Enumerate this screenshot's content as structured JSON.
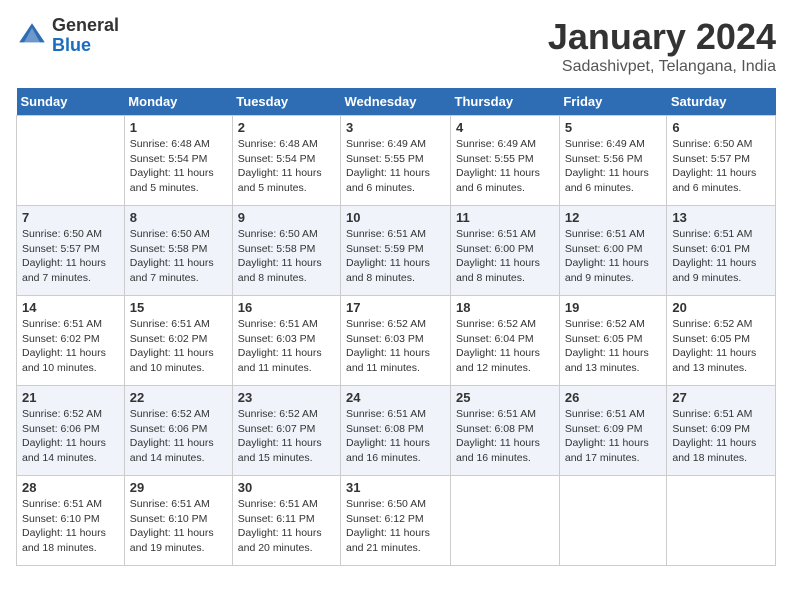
{
  "header": {
    "logo_general": "General",
    "logo_blue": "Blue",
    "month_title": "January 2024",
    "location": "Sadashivpet, Telangana, India"
  },
  "days_of_week": [
    "Sunday",
    "Monday",
    "Tuesday",
    "Wednesday",
    "Thursday",
    "Friday",
    "Saturday"
  ],
  "weeks": [
    [
      {
        "day": "",
        "sunrise": "",
        "sunset": "",
        "daylight": ""
      },
      {
        "day": "1",
        "sunrise": "Sunrise: 6:48 AM",
        "sunset": "Sunset: 5:54 PM",
        "daylight": "Daylight: 11 hours and 5 minutes."
      },
      {
        "day": "2",
        "sunrise": "Sunrise: 6:48 AM",
        "sunset": "Sunset: 5:54 PM",
        "daylight": "Daylight: 11 hours and 5 minutes."
      },
      {
        "day": "3",
        "sunrise": "Sunrise: 6:49 AM",
        "sunset": "Sunset: 5:55 PM",
        "daylight": "Daylight: 11 hours and 6 minutes."
      },
      {
        "day": "4",
        "sunrise": "Sunrise: 6:49 AM",
        "sunset": "Sunset: 5:55 PM",
        "daylight": "Daylight: 11 hours and 6 minutes."
      },
      {
        "day": "5",
        "sunrise": "Sunrise: 6:49 AM",
        "sunset": "Sunset: 5:56 PM",
        "daylight": "Daylight: 11 hours and 6 minutes."
      },
      {
        "day": "6",
        "sunrise": "Sunrise: 6:50 AM",
        "sunset": "Sunset: 5:57 PM",
        "daylight": "Daylight: 11 hours and 6 minutes."
      }
    ],
    [
      {
        "day": "7",
        "sunrise": "Sunrise: 6:50 AM",
        "sunset": "Sunset: 5:57 PM",
        "daylight": "Daylight: 11 hours and 7 minutes."
      },
      {
        "day": "8",
        "sunrise": "Sunrise: 6:50 AM",
        "sunset": "Sunset: 5:58 PM",
        "daylight": "Daylight: 11 hours and 7 minutes."
      },
      {
        "day": "9",
        "sunrise": "Sunrise: 6:50 AM",
        "sunset": "Sunset: 5:58 PM",
        "daylight": "Daylight: 11 hours and 8 minutes."
      },
      {
        "day": "10",
        "sunrise": "Sunrise: 6:51 AM",
        "sunset": "Sunset: 5:59 PM",
        "daylight": "Daylight: 11 hours and 8 minutes."
      },
      {
        "day": "11",
        "sunrise": "Sunrise: 6:51 AM",
        "sunset": "Sunset: 6:00 PM",
        "daylight": "Daylight: 11 hours and 8 minutes."
      },
      {
        "day": "12",
        "sunrise": "Sunrise: 6:51 AM",
        "sunset": "Sunset: 6:00 PM",
        "daylight": "Daylight: 11 hours and 9 minutes."
      },
      {
        "day": "13",
        "sunrise": "Sunrise: 6:51 AM",
        "sunset": "Sunset: 6:01 PM",
        "daylight": "Daylight: 11 hours and 9 minutes."
      }
    ],
    [
      {
        "day": "14",
        "sunrise": "Sunrise: 6:51 AM",
        "sunset": "Sunset: 6:02 PM",
        "daylight": "Daylight: 11 hours and 10 minutes."
      },
      {
        "day": "15",
        "sunrise": "Sunrise: 6:51 AM",
        "sunset": "Sunset: 6:02 PM",
        "daylight": "Daylight: 11 hours and 10 minutes."
      },
      {
        "day": "16",
        "sunrise": "Sunrise: 6:51 AM",
        "sunset": "Sunset: 6:03 PM",
        "daylight": "Daylight: 11 hours and 11 minutes."
      },
      {
        "day": "17",
        "sunrise": "Sunrise: 6:52 AM",
        "sunset": "Sunset: 6:03 PM",
        "daylight": "Daylight: 11 hours and 11 minutes."
      },
      {
        "day": "18",
        "sunrise": "Sunrise: 6:52 AM",
        "sunset": "Sunset: 6:04 PM",
        "daylight": "Daylight: 11 hours and 12 minutes."
      },
      {
        "day": "19",
        "sunrise": "Sunrise: 6:52 AM",
        "sunset": "Sunset: 6:05 PM",
        "daylight": "Daylight: 11 hours and 13 minutes."
      },
      {
        "day": "20",
        "sunrise": "Sunrise: 6:52 AM",
        "sunset": "Sunset: 6:05 PM",
        "daylight": "Daylight: 11 hours and 13 minutes."
      }
    ],
    [
      {
        "day": "21",
        "sunrise": "Sunrise: 6:52 AM",
        "sunset": "Sunset: 6:06 PM",
        "daylight": "Daylight: 11 hours and 14 minutes."
      },
      {
        "day": "22",
        "sunrise": "Sunrise: 6:52 AM",
        "sunset": "Sunset: 6:06 PM",
        "daylight": "Daylight: 11 hours and 14 minutes."
      },
      {
        "day": "23",
        "sunrise": "Sunrise: 6:52 AM",
        "sunset": "Sunset: 6:07 PM",
        "daylight": "Daylight: 11 hours and 15 minutes."
      },
      {
        "day": "24",
        "sunrise": "Sunrise: 6:51 AM",
        "sunset": "Sunset: 6:08 PM",
        "daylight": "Daylight: 11 hours and 16 minutes."
      },
      {
        "day": "25",
        "sunrise": "Sunrise: 6:51 AM",
        "sunset": "Sunset: 6:08 PM",
        "daylight": "Daylight: 11 hours and 16 minutes."
      },
      {
        "day": "26",
        "sunrise": "Sunrise: 6:51 AM",
        "sunset": "Sunset: 6:09 PM",
        "daylight": "Daylight: 11 hours and 17 minutes."
      },
      {
        "day": "27",
        "sunrise": "Sunrise: 6:51 AM",
        "sunset": "Sunset: 6:09 PM",
        "daylight": "Daylight: 11 hours and 18 minutes."
      }
    ],
    [
      {
        "day": "28",
        "sunrise": "Sunrise: 6:51 AM",
        "sunset": "Sunset: 6:10 PM",
        "daylight": "Daylight: 11 hours and 18 minutes."
      },
      {
        "day": "29",
        "sunrise": "Sunrise: 6:51 AM",
        "sunset": "Sunset: 6:10 PM",
        "daylight": "Daylight: 11 hours and 19 minutes."
      },
      {
        "day": "30",
        "sunrise": "Sunrise: 6:51 AM",
        "sunset": "Sunset: 6:11 PM",
        "daylight": "Daylight: 11 hours and 20 minutes."
      },
      {
        "day": "31",
        "sunrise": "Sunrise: 6:50 AM",
        "sunset": "Sunset: 6:12 PM",
        "daylight": "Daylight: 11 hours and 21 minutes."
      },
      {
        "day": "",
        "sunrise": "",
        "sunset": "",
        "daylight": ""
      },
      {
        "day": "",
        "sunrise": "",
        "sunset": "",
        "daylight": ""
      },
      {
        "day": "",
        "sunrise": "",
        "sunset": "",
        "daylight": ""
      }
    ]
  ]
}
